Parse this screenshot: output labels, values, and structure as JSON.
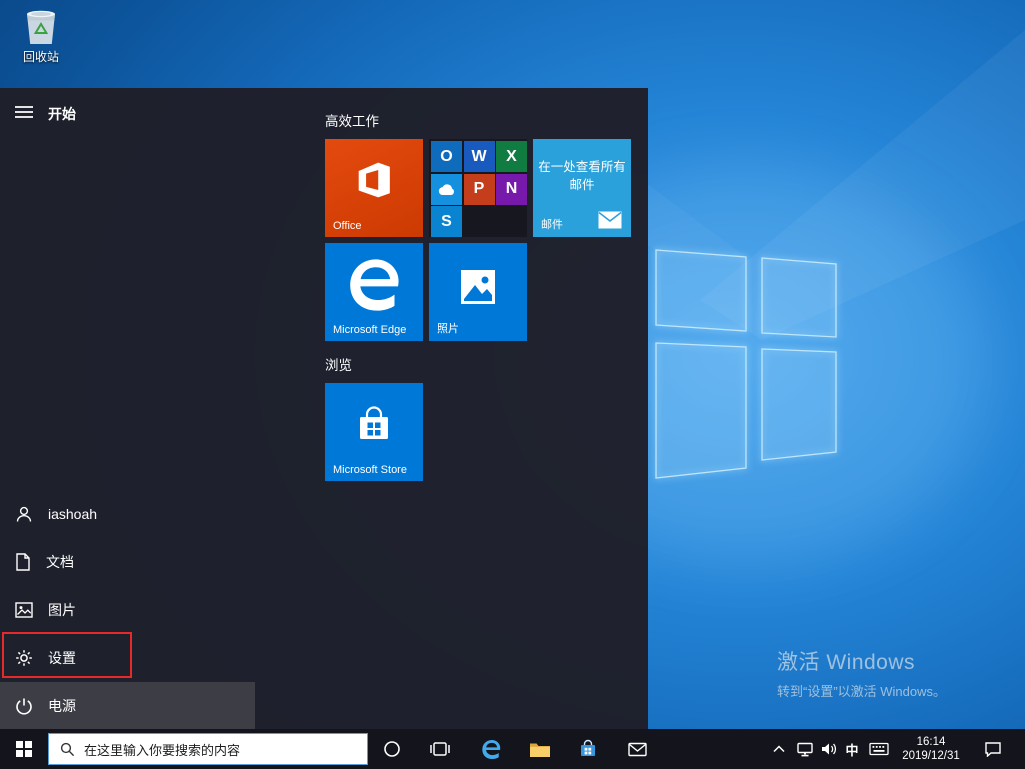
{
  "desktop": {
    "recycle_bin_label": "回收站",
    "watermark_line1": "激活 Windows",
    "watermark_line2": "转到“设置”以激活 Windows。"
  },
  "start_menu": {
    "title": "开始",
    "group1_header": "高效工作",
    "group2_header": "浏览",
    "tiles": {
      "office_label": "Office",
      "mail_headline": "在一处查看所有邮件",
      "mail_label": "邮件",
      "edge_label": "Microsoft Edge",
      "photos_label": "照片",
      "store_label": "Microsoft Store",
      "suite": [
        {
          "name": "Outlook",
          "letter": "O",
          "color": "#0f6cbd"
        },
        {
          "name": "Word",
          "letter": "W",
          "color": "#185abd"
        },
        {
          "name": "Excel",
          "letter": "X",
          "color": "#107c41"
        },
        {
          "name": "OneDrive",
          "letter": "",
          "color": "#1490df"
        },
        {
          "name": "PowerPoint",
          "letter": "P",
          "color": "#c43e1c"
        },
        {
          "name": "OneNote",
          "letter": "N",
          "color": "#7719aa"
        },
        {
          "name": "Skype",
          "letter": "S",
          "color": "#0a84d0"
        }
      ]
    },
    "rail": {
      "user": "iashoah",
      "documents": "文档",
      "pictures": "图片",
      "settings": "设置",
      "power": "电源"
    }
  },
  "taskbar": {
    "search_placeholder": "在这里输入你要搜索的内容",
    "ime_indicator": "中",
    "time": "16:14",
    "date": "2019/12/31"
  },
  "colors": {
    "accent_blue": "#0078d7",
    "office_tile": "#d83b01",
    "mail_tile": "#2aa1da",
    "menu_bg": "#1f1f28",
    "taskbar_bg": "#14141c",
    "highlight_red": "#e42a2a"
  }
}
